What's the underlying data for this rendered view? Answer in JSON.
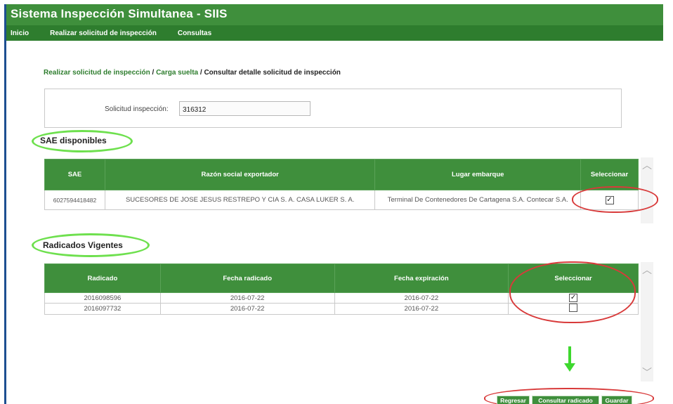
{
  "app": {
    "title": "Sistema Inspección Simultanea - SIIS"
  },
  "nav": {
    "items": [
      "Inicio",
      "Realizar solicitud de inspección",
      "Consultas"
    ]
  },
  "breadcrumb": {
    "link1": "Realizar solicitud de inspección",
    "sep1": " / ",
    "link2": "Carga suelta",
    "sep2": " / ",
    "current": "Consultar detalle solicitud de inspección"
  },
  "search": {
    "label": "Solicitud inspección:",
    "value": "316312"
  },
  "sae": {
    "title": "SAE disponibles",
    "headers": [
      "SAE",
      "Razón social exportador",
      "Lugar embarque",
      "Seleccionar"
    ],
    "rows": [
      {
        "sae": "6027594418482",
        "razon": "SUCESORES DE JOSE JESUS RESTREPO Y CIA S. A. CASA LUKER S. A.",
        "lugar": "Terminal De Contenedores De Cartagena S.A. Contecar S.A.",
        "checked": true
      }
    ]
  },
  "radicados": {
    "title": "Radicados Vigentes",
    "headers": [
      "Radicado",
      "Fecha radicado",
      "Fecha expiración",
      "Seleccionar"
    ],
    "rows": [
      {
        "radicado": "2016098596",
        "fecha_radicado": "2016-07-22",
        "fecha_expiracion": "2016-07-22",
        "checked": true
      },
      {
        "radicado": "2016097732",
        "fecha_radicado": "2016-07-22",
        "fecha_expiracion": "2016-07-22",
        "checked": false
      }
    ]
  },
  "buttons": {
    "regresar": "Regresar",
    "consultar": "Consultar radicado",
    "guardar": "Guardar"
  },
  "colors": {
    "header_green": "#3f8f3c",
    "nav_green": "#2e7d2e",
    "annotation_green": "#6ee04e",
    "annotation_red": "#d83a3a"
  },
  "icons": {
    "checkbox_checked": "check-icon",
    "scroll_up": "chevron-up-icon",
    "scroll_down": "chevron-down-icon",
    "annotation_arrow": "arrow-down-icon"
  }
}
